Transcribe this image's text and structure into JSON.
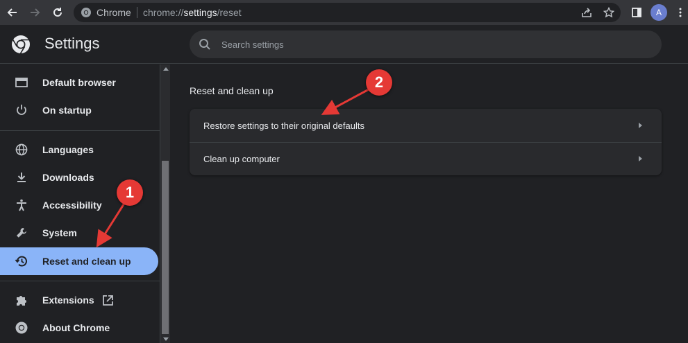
{
  "browser": {
    "site_label": "Chrome",
    "url_prefix": "chrome://",
    "url_host": "settings",
    "url_path": "/reset",
    "avatar_initial": "A"
  },
  "header": {
    "title": "Settings",
    "search_placeholder": "Search settings"
  },
  "sidebar": {
    "items": [
      {
        "label": "Default browser",
        "icon": "browser-window-icon"
      },
      {
        "label": "On startup",
        "icon": "power-icon"
      },
      {
        "label": "Languages",
        "icon": "globe-icon"
      },
      {
        "label": "Downloads",
        "icon": "download-icon"
      },
      {
        "label": "Accessibility",
        "icon": "accessibility-icon"
      },
      {
        "label": "System",
        "icon": "wrench-icon"
      },
      {
        "label": "Reset and clean up",
        "icon": "history-reset-icon",
        "active": true
      },
      {
        "label": "Extensions",
        "icon": "puzzle-icon"
      },
      {
        "label": "About Chrome",
        "icon": "chrome-logo-icon"
      }
    ]
  },
  "main": {
    "section_title": "Reset and clean up",
    "rows": [
      {
        "label": "Restore settings to their original defaults"
      },
      {
        "label": "Clean up computer"
      }
    ]
  },
  "annotations": {
    "badge_1": "1",
    "badge_2": "2",
    "color": "#e53935"
  },
  "colors": {
    "active_nav": "#8ab4f8",
    "background": "#202124",
    "toolbar": "#35363a"
  }
}
